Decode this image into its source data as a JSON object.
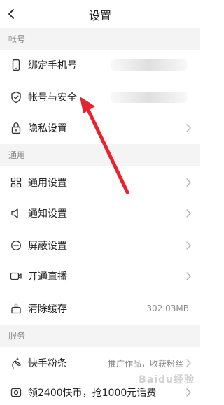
{
  "header": {
    "title": "设置"
  },
  "sections": [
    {
      "title": "帐号",
      "items": [
        {
          "label": "绑定手机号",
          "icon": "phone-icon"
        },
        {
          "label": "帐号与安全",
          "icon": "shield-icon"
        },
        {
          "label": "隐私设置",
          "icon": "lock-icon"
        }
      ]
    },
    {
      "title": "通用",
      "items": [
        {
          "label": "通用设置",
          "icon": "grid-icon"
        },
        {
          "label": "通知设置",
          "icon": "speaker-icon"
        },
        {
          "label": "屏蔽设置",
          "icon": "block-icon"
        },
        {
          "label": "开通直播",
          "icon": "video-icon"
        },
        {
          "label": "清除缓存",
          "icon": "broom-icon",
          "value": "302.03MB"
        }
      ]
    },
    {
      "title": "服务",
      "items": [
        {
          "label": "快手粉条",
          "icon": "sparkle-plant-icon",
          "value": "推广作品，收获粉丝"
        },
        {
          "label": "领2400快币，抢1000元话费",
          "icon": "coin-card-icon"
        }
      ]
    }
  ],
  "annotation": {
    "color": "#e8232f"
  },
  "watermark": "Baidu经验"
}
